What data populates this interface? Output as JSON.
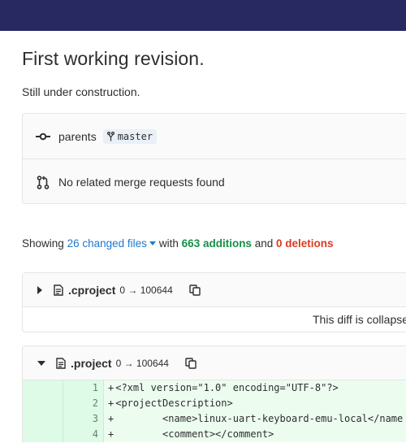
{
  "commit": {
    "title": "First working revision.",
    "description": "Still under construction."
  },
  "info": {
    "parents_label": "parents",
    "branch": "master",
    "merge_requests": "No related merge requests found"
  },
  "summary": {
    "prefix": "Showing",
    "changed_files": "26 changed files",
    "with": "with",
    "additions": "663 additions",
    "and": "and",
    "deletions": "0 deletions"
  },
  "files": [
    {
      "name": ".cproject",
      "mode": "0 → 100644",
      "collapsed_message": "This diff is collapse"
    },
    {
      "name": ".project",
      "mode": "0 → 100644",
      "lines": [
        {
          "num": "1",
          "text": "<?xml version=\"1.0\" encoding=\"UTF-8\"?>"
        },
        {
          "num": "2",
          "text": "<projectDescription>"
        },
        {
          "num": "3",
          "text": "        <name>linux-uart-keyboard-emu-local</name"
        },
        {
          "num": "4",
          "text": "        <comment></comment>"
        }
      ]
    }
  ],
  "colors": {
    "topbar": "#292961",
    "link": "#1f78d1",
    "additions": "#168f48",
    "deletions": "#db3b21",
    "diff_added_bg": "#ecfdf0"
  },
  "icons": {
    "commit": "commit-icon",
    "branch": "branch-icon",
    "merge_request": "merge-request-icon",
    "file": "file-text-icon",
    "copy": "copy-icon"
  }
}
